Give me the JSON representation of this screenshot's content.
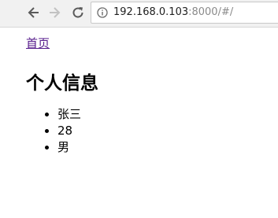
{
  "browser": {
    "url_host": "192.168.0.103",
    "url_rest": ":8000/#/",
    "icons": {
      "back": "arrow-left-icon",
      "forward": "arrow-right-icon",
      "reload": "reload-icon",
      "info": "info-icon"
    }
  },
  "page": {
    "home_link": "首页",
    "title": "个人信息",
    "info_items": [
      "张三",
      "28",
      "男"
    ]
  }
}
